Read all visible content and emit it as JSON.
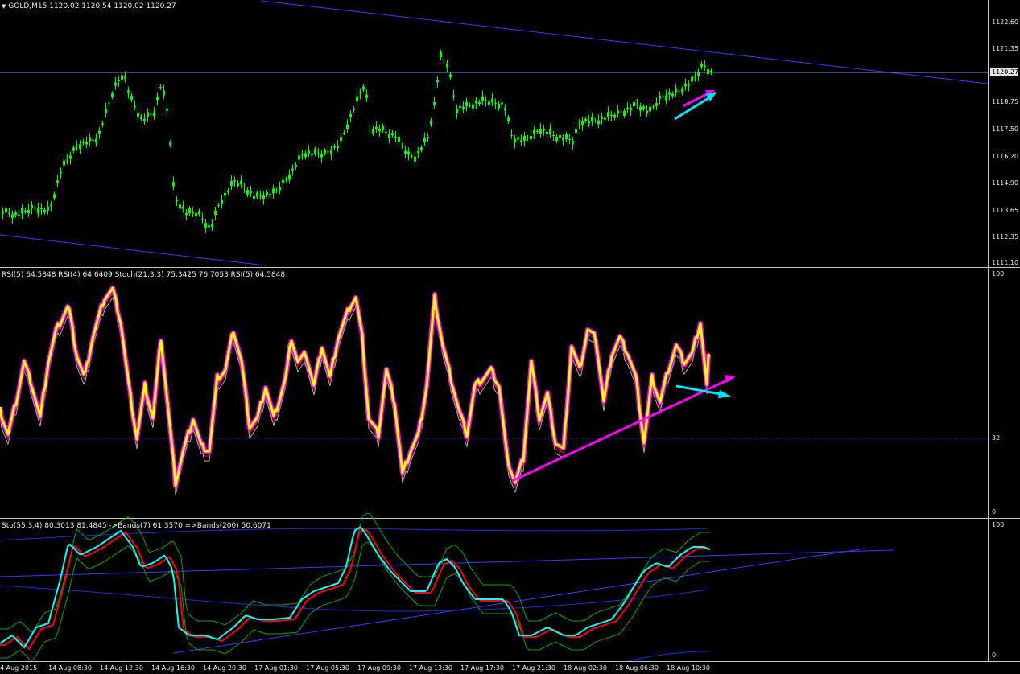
{
  "main": {
    "symbol_header": "GOLD,M15  1120.02 1120.54 1120.02 1120.27",
    "price_labels": [
      "1122.60",
      "1121.35",
      "1118.75",
      "1117.50",
      "1116.20",
      "1114.90",
      "1113.65",
      "1112.35",
      "1111.10"
    ],
    "current_price": "1120.27",
    "colors": {
      "candle": "#00ff00",
      "trend_line": "#3a3aff",
      "price_line": "#7a8bd9",
      "arrow_magenta": "#ff00ff",
      "arrow_cyan": "#00e5ff"
    }
  },
  "rsi_panel": {
    "header": "RSI(5) 64.5848  RSI(4) 64.6409  Stoch(21,3,3) 75.3425 76.7053  RSI(5) 64.5848",
    "levels": [
      "100",
      "32",
      "0"
    ],
    "colors": {
      "rsi_main": "#ffff00",
      "rsi_outline": "#ff00ff",
      "stoch": "#b0b0b0",
      "signal": "#ff0000",
      "level_line": "#2a35c8"
    }
  },
  "sto_panel": {
    "header": "Sto(55,3,4) 80.3013 81.4845  ->Bands(7) 61.3570  =>Bands(200) 50.6071",
    "levels": [
      "100",
      "0"
    ],
    "colors": {
      "sto_main": "#00ffff",
      "sto_signal": "#ff0000",
      "bands7": "#00aa00",
      "bands200": "#1c2de0",
      "trend": "#3a3aff"
    }
  },
  "time_axis": [
    "4 Aug 2015",
    "14 Aug 08:30",
    "14 Aug 12:30",
    "14 Aug 16:30",
    "14 Aug 20:30",
    "17 Aug 01:30",
    "17 Aug 05:30",
    "17 Aug 09:30",
    "17 Aug 13:30",
    "17 Aug 17:30",
    "17 Aug 21:30",
    "18 Aug 02:30",
    "18 Aug 06:30",
    "18 Aug 10:30"
  ]
}
